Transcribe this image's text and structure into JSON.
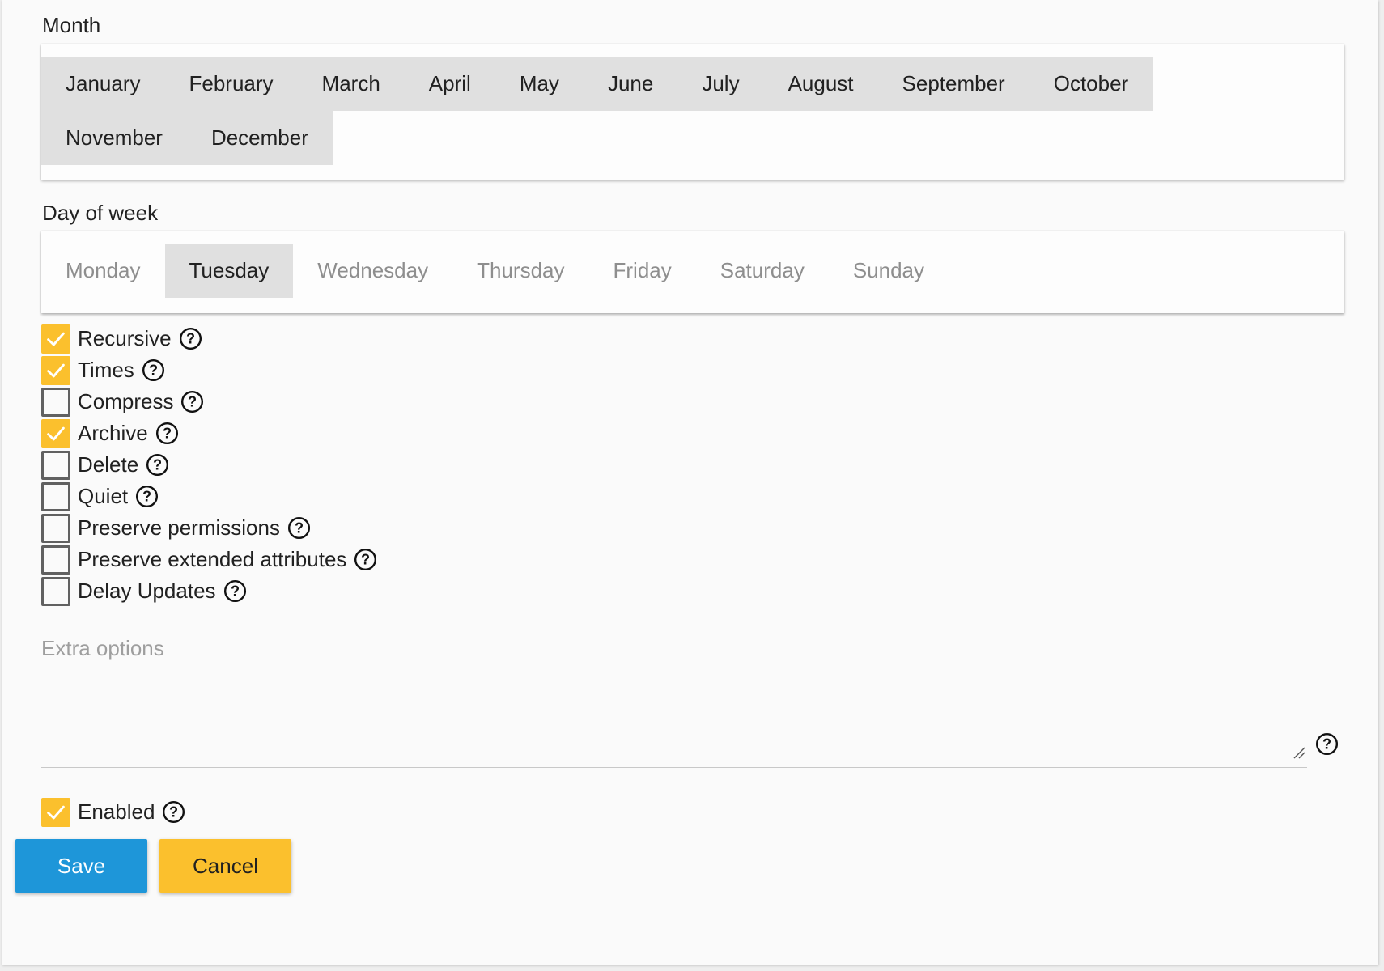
{
  "month": {
    "label": "Month",
    "options": [
      "January",
      "February",
      "March",
      "April",
      "May",
      "June",
      "July",
      "August",
      "September",
      "October",
      "November",
      "December"
    ],
    "selected": [
      "January",
      "February",
      "March",
      "April",
      "May",
      "June",
      "July",
      "August",
      "September",
      "October",
      "November",
      "December"
    ]
  },
  "day_of_week": {
    "label": "Day of week",
    "options": [
      "Monday",
      "Tuesday",
      "Wednesday",
      "Thursday",
      "Friday",
      "Saturday",
      "Sunday"
    ],
    "selected": [
      "Tuesday"
    ]
  },
  "options": [
    {
      "label": "Recursive",
      "checked": true
    },
    {
      "label": "Times",
      "checked": true
    },
    {
      "label": "Compress",
      "checked": false
    },
    {
      "label": "Archive",
      "checked": true
    },
    {
      "label": "Delete",
      "checked": false
    },
    {
      "label": "Quiet",
      "checked": false
    },
    {
      "label": "Preserve permissions",
      "checked": false
    },
    {
      "label": "Preserve extended attributes",
      "checked": false
    },
    {
      "label": "Delay Updates",
      "checked": false
    }
  ],
  "extra_options": {
    "placeholder": "Extra options",
    "value": ""
  },
  "enabled": {
    "label": "Enabled",
    "checked": true
  },
  "buttons": {
    "save_label": "Save",
    "cancel_label": "Cancel"
  },
  "icons": {
    "check": "check-icon",
    "help": "help-circle-icon",
    "resize": "resize-handle-icon"
  },
  "colors": {
    "primary": "#1e96d9",
    "accent": "#fbc02d",
    "chip_selected": "#e0e0e0",
    "unselected_text": "#8e8e8e"
  }
}
